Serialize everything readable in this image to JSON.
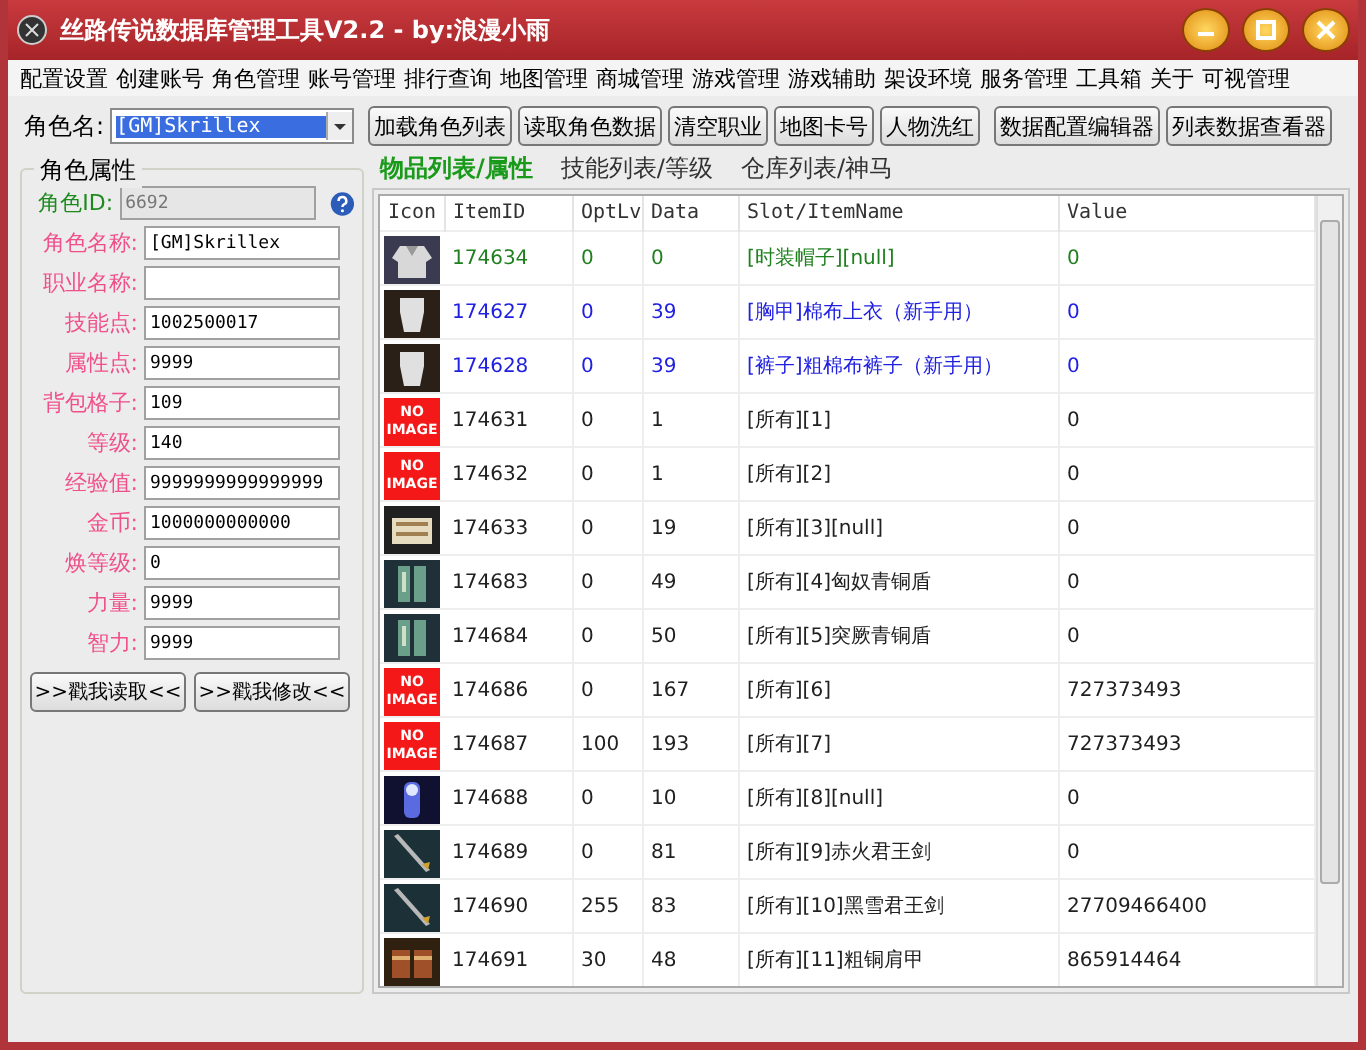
{
  "window": {
    "title": "丝路传说数据库管理工具V2.2 - by:浪漫小雨"
  },
  "menu": [
    "配置设置",
    "创建账号",
    "角色管理",
    "账号管理",
    "排行查询",
    "地图管理",
    "商城管理",
    "游戏管理",
    "游戏辅助",
    "架设环境",
    "服务管理",
    "工具箱",
    "关于",
    "可视管理"
  ],
  "toolbar": {
    "label": "角色名:",
    "combo_value": "[GM]Skrillex",
    "buttons": [
      "加载角色列表",
      "读取角色数据",
      "清空职业",
      "地图卡号",
      "人物洗红",
      "数据配置编辑器",
      "列表数据查看器"
    ]
  },
  "tabs": [
    {
      "label": "物品列表/属性",
      "selected": true
    },
    {
      "label": "技能列表/等级",
      "selected": false
    },
    {
      "label": "仓库列表/神马",
      "selected": false
    }
  ],
  "attributes": {
    "title": "角色属性",
    "fields": [
      {
        "label": "角色ID:",
        "value": "6692",
        "disabled": true,
        "help": true
      },
      {
        "label": "角色名称:",
        "value": "[GM]Skrillex",
        "disabled": false
      },
      {
        "label": "职业名称:",
        "disabled": false
      },
      {
        "label": "技能点:",
        "value": "1002500017",
        "disabled": false
      },
      {
        "label": "属性点:",
        "value": "9999",
        "disabled": false
      },
      {
        "label": "背包格子:",
        "value": "109",
        "disabled": false
      },
      {
        "label": "等级:",
        "value": "140",
        "disabled": false
      },
      {
        "label": "经验值:",
        "value": "9999999999999999",
        "disabled": false
      },
      {
        "label": "金币:",
        "value": "1000000000000",
        "disabled": false
      },
      {
        "label": "焕等级:",
        "value": "0",
        "disabled": false
      },
      {
        "label": "力量:",
        "value": "9999",
        "disabled": false
      },
      {
        "label": "智力:",
        "value": "9999",
        "disabled": false
      }
    ],
    "buttons": [
      ">>戳我读取<<",
      ">>戳我修改<<"
    ]
  },
  "table": {
    "icon_column": "Icon",
    "columns": [
      "ItemID",
      "OptLv",
      "Data",
      "Slot/ItemName",
      "Value"
    ],
    "rows": [
      {
        "color": "#208020",
        "cells": [
          "174634",
          "0",
          "0",
          "[时装帽子][null]",
          "0"
        ]
      },
      {
        "color": "#2020e0",
        "cells": [
          "174627",
          "0",
          "39",
          "[胸甲]棉布上衣（新手用）",
          "0"
        ]
      },
      {
        "color": "#2020e0",
        "cells": [
          "174628",
          "0",
          "39",
          "[裤子]粗棉布裤子（新手用）",
          "0"
        ]
      },
      {
        "icon": {
          "kind": "missing",
          "text": "NO IMAGE"
        },
        "color": "#202020",
        "cells": [
          "174631",
          "0",
          "1",
          "[所有][1]",
          "0"
        ]
      },
      {
        "icon": {
          "kind": "missing",
          "text": "NO IMAGE"
        },
        "color": "#202020",
        "cells": [
          "174632",
          "0",
          "1",
          "[所有][2]",
          "0"
        ]
      },
      {
        "color": "#202020",
        "cells": [
          "174633",
          "0",
          "19",
          "[所有][3][null]",
          "0"
        ]
      },
      {
        "color": "#202020",
        "cells": [
          "174683",
          "0",
          "49",
          "[所有][4]匈奴青铜盾",
          "0"
        ]
      },
      {
        "color": "#202020",
        "cells": [
          "174684",
          "0",
          "50",
          "[所有][5]突厥青铜盾",
          "0"
        ]
      },
      {
        "icon": {
          "kind": "missing",
          "text": "NO IMAGE"
        },
        "color": "#202020",
        "cells": [
          "174686",
          "0",
          "167",
          "[所有][6]",
          "727373493"
        ]
      },
      {
        "icon": {
          "kind": "missing",
          "text": "NO IMAGE"
        },
        "color": "#202020",
        "cells": [
          "174687",
          "100",
          "193",
          "[所有][7]",
          "727373493"
        ]
      },
      {
        "color": "#202020",
        "cells": [
          "174688",
          "0",
          "10",
          "[所有][8][null]",
          "0"
        ]
      },
      {
        "color": "#202020",
        "cells": [
          "174689",
          "0",
          "81",
          "[所有][9]赤火君王剑",
          "0"
        ]
      },
      {
        "color": "#202020",
        "cells": [
          "174690",
          "255",
          "83",
          "[所有][10]黑雪君王剑",
          "27709466400"
        ]
      },
      {
        "color": "#202020",
        "cells": [
          "174691",
          "30",
          "48",
          "[所有][11]粗铜肩甲",
          "865914464"
        ]
      }
    ]
  }
}
